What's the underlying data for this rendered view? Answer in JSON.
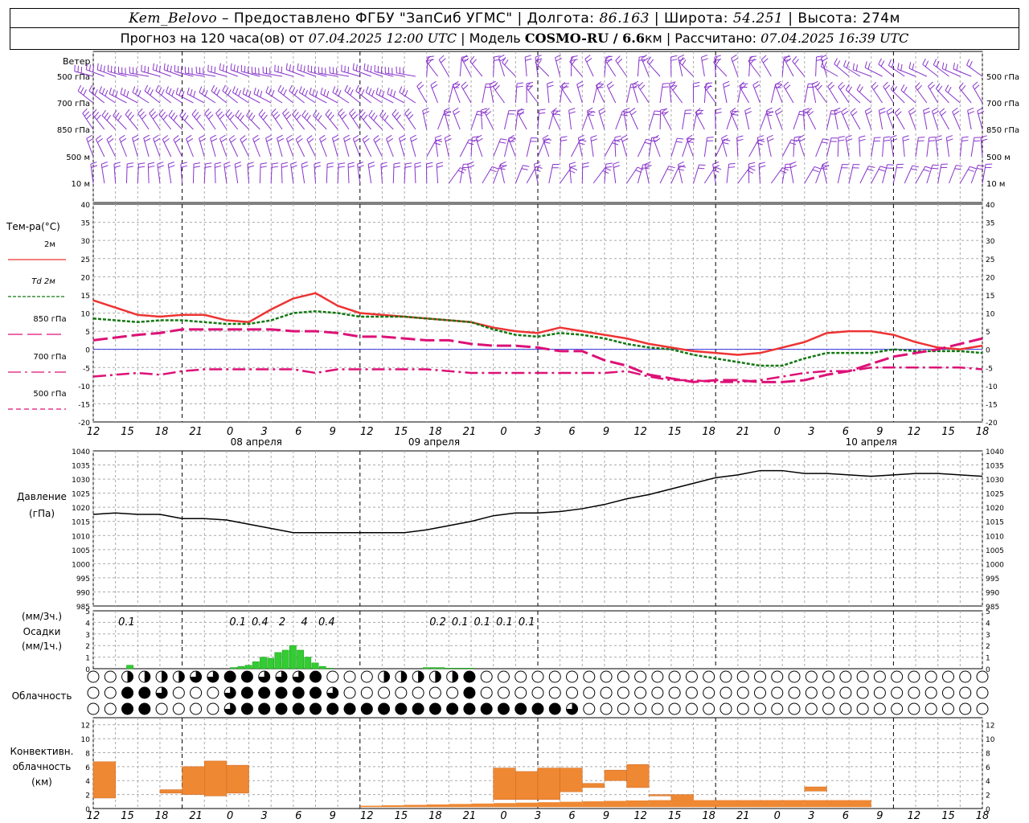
{
  "header": {
    "station": "Kem_Belovo",
    "provided_label": "– Предоставлено ФГБУ \"ЗапСиб УГМС\" | Долгота:",
    "lon": "86.163",
    "lat_label": "| Широта:",
    "lat": "54.251",
    "alt_label": "| Высота:",
    "alt": "274м",
    "forecast_label": "Прогноз на 120 часа(ов) от",
    "init_time": "07.04.2025 12:00 UTC",
    "model_label": "| Модель",
    "model": "COSMO-RU / 6.6",
    "model_unit": "км",
    "calc_label": "| Рассчитано:",
    "calc_time": "07.04.2025 16:39 UTC"
  },
  "wind_panel": {
    "title": "Ветер",
    "levels": [
      "500 гПа",
      "700 гПа",
      "850 гПа",
      "500 м",
      "10 м"
    ],
    "right_levels": [
      "500 гПа",
      "700 гПа",
      "850 гПа",
      "500 м",
      "10 м"
    ]
  },
  "temp_panel": {
    "title": "Тем-ра(°С)",
    "legend": [
      {
        "label": "2м",
        "color": "#ee3333"
      },
      {
        "label": "Td 2м",
        "color": "#117711"
      },
      {
        "label": "850 гПа",
        "color": "#dd1177"
      },
      {
        "label": "700 гПа",
        "color": "#dd1177"
      },
      {
        "label": "500 гПа",
        "color": "#dd1177"
      }
    ]
  },
  "pressure_panel": {
    "title": "Давление",
    "unit": "(гПа)"
  },
  "precip_panel": {
    "unit3": "(мм/3ч.)",
    "title": "Осадки",
    "unit1": "(мм/1ч.)"
  },
  "cloud_panel": {
    "title": "Облачность"
  },
  "conv_panel": {
    "title1": "Конвективн.",
    "title2": "облачность",
    "unit": "(км)"
  },
  "time_axis": {
    "labels": [
      "12",
      "15",
      "18",
      "21",
      "0",
      "3",
      "6",
      "9",
      "12",
      "15",
      "18",
      "21",
      "0",
      "3",
      "6",
      "9",
      "12",
      "15",
      "18",
      "21",
      "0",
      "3",
      "6",
      "9",
      "12",
      "15",
      "18"
    ],
    "dates": [
      "08 апреля",
      "09 апреля",
      "10 апреля"
    ]
  },
  "colors": {
    "wind": "#8833cc",
    "precip": "#33cc33",
    "conv": "#ee8833",
    "grid": "#aaaaaa",
    "zero": "#3333dd"
  },
  "chart_data": [
    {
      "type": "line",
      "title": "Тем-ра(°С)",
      "x_hours_from_init": [
        0,
        6,
        9,
        12,
        15,
        18,
        21,
        24,
        27,
        30,
        33,
        36,
        39,
        42,
        45,
        48,
        51,
        54,
        57,
        60,
        63,
        66,
        69,
        72,
        75,
        78,
        81,
        84,
        87,
        90,
        93,
        96,
        99,
        102,
        105,
        108,
        111,
        114,
        117,
        120
      ],
      "ylim": [
        -20,
        40
      ],
      "ticks": [
        40,
        35,
        30,
        25,
        20,
        15,
        10,
        5,
        0,
        -5,
        -10,
        -15,
        -20
      ],
      "series": [
        {
          "name": "2м",
          "values": [
            13.5,
            9.5,
            9,
            9.5,
            9.5,
            8,
            7.5,
            11,
            14,
            15.5,
            12,
            10,
            9.5,
            9,
            8.5,
            8,
            7.5,
            6,
            5,
            4.5,
            6,
            5,
            4,
            3,
            1.5,
            0.5,
            -0.5,
            -1,
            -1.5,
            -1,
            0.5,
            2,
            4.5,
            5,
            5,
            4,
            2,
            0.5,
            0,
            1
          ]
        },
        {
          "name": "Td 2м",
          "values": [
            8.5,
            7.5,
            8,
            8,
            7.5,
            7,
            7,
            8,
            10,
            10.5,
            10,
            9,
            9,
            9,
            8.5,
            8,
            7.5,
            5.5,
            4,
            3.5,
            4.5,
            4,
            3,
            1.5,
            0.5,
            0,
            -1.5,
            -2.5,
            -3.5,
            -4.5,
            -4.5,
            -2.5,
            -1,
            -1,
            -1,
            0,
            -0.5,
            -0.5,
            -0.5,
            -1
          ]
        },
        {
          "name": "850 гПа",
          "values": [
            2.5,
            4,
            4.5,
            5.5,
            5.5,
            5.5,
            5.5,
            5.5,
            5,
            5,
            4.5,
            3.5,
            3.5,
            3,
            2.5,
            2.5,
            1.5,
            1,
            1,
            0.5,
            -0.5,
            -0.5,
            -3,
            -4.5,
            -7,
            -8,
            -9,
            -8.5,
            -8.5,
            -9,
            -9,
            -8.5,
            -7,
            -6,
            -4,
            -2,
            -1,
            0,
            1.5,
            3
          ]
        },
        {
          "name": "700 гПа",
          "values": [
            -7.5,
            -6.5,
            -7,
            -6,
            -5.5,
            -5.5,
            -5.5,
            -5.5,
            -5.5,
            -6.5,
            -5.5,
            -5.5,
            -5.5,
            -5.5,
            -5.5,
            -6,
            -6.5,
            -6.5,
            -6.5,
            -6.5,
            -6.5,
            -6.5,
            -6.5,
            -6,
            -7.5,
            -8.5,
            -8.5,
            -9,
            -9,
            -8.5,
            -7.5,
            -6.5,
            -6,
            -6,
            -5,
            -5,
            -5,
            -5,
            -5,
            -5.5
          ]
        }
      ]
    },
    {
      "type": "line",
      "title": "Давление",
      "ylabel": "(гПа)",
      "ylim": [
        985,
        1040
      ],
      "ticks": [
        1040,
        1035,
        1030,
        1025,
        1020,
        1015,
        1010,
        1005,
        1000,
        995,
        990,
        985
      ],
      "x_hours_from_init": [
        0,
        3,
        6,
        9,
        12,
        15,
        18,
        21,
        24,
        27,
        30,
        33,
        36,
        39,
        42,
        45,
        48,
        51,
        54,
        57,
        60,
        63,
        66,
        69,
        72,
        75,
        78,
        81,
        84,
        87,
        90,
        93,
        96,
        99,
        102,
        105,
        108,
        111,
        114,
        117,
        120
      ],
      "values": [
        1017.5,
        1018,
        1017.5,
        1017.5,
        1016,
        1016,
        1015.5,
        1014,
        1012.5,
        1011,
        1011,
        1011,
        1011,
        1011,
        1011,
        1012,
        1013.5,
        1015,
        1017,
        1018,
        1018,
        1018.5,
        1019.5,
        1021,
        1023,
        1024.5,
        1026.5,
        1028.5,
        1030.5,
        1031.5,
        1033,
        1033,
        1032,
        1032,
        1031.5,
        1031,
        1031.5,
        1032,
        1032,
        1031.5,
        1031
      ]
    },
    {
      "type": "bar",
      "title": "Осадки",
      "ylabel": "(мм/1ч.)",
      "ylim": [
        0,
        5
      ],
      "ticks": [
        5,
        4,
        3,
        2,
        1,
        0
      ],
      "x_hours_from_init": [
        5,
        19,
        20,
        21,
        22,
        23,
        24,
        25,
        26,
        27,
        28,
        29,
        30,
        31,
        32,
        45,
        46,
        47,
        48,
        49,
        50,
        51
      ],
      "values_hourly": [
        0.3,
        0.1,
        0.2,
        0.3,
        0.6,
        1,
        0.9,
        1.4,
        1.6,
        2,
        1.6,
        1,
        0.5,
        0.2,
        0.05,
        0.1,
        0.1,
        0.1,
        0.05,
        0.05,
        0.05,
        0.05
      ],
      "labels_3h": [
        {
          "x_hours_from_init": 4.5,
          "text": "0.1"
        },
        {
          "x_hours_from_init": 19.5,
          "text": "0.1"
        },
        {
          "x_hours_from_init": 22.5,
          "text": "0.4"
        },
        {
          "x_hours_from_init": 25.5,
          "text": "2"
        },
        {
          "x_hours_from_init": 28.5,
          "text": "4"
        },
        {
          "x_hours_from_init": 31.5,
          "text": "0.4"
        },
        {
          "x_hours_from_init": 46.5,
          "text": "0.2"
        },
        {
          "x_hours_from_init": 49.5,
          "text": "0.1"
        },
        {
          "x_hours_from_init": 52.5,
          "text": "0.1"
        },
        {
          "x_hours_from_init": 55.5,
          "text": "0.1"
        },
        {
          "x_hours_from_init": 58.5,
          "text": "0.1"
        }
      ]
    },
    {
      "type": "bar",
      "title": "Конвективн. облачность",
      "ylabel": "(км)",
      "ylim": [
        0,
        13
      ],
      "ticks": [
        12,
        10,
        8,
        6,
        4,
        2,
        0
      ],
      "ranges_km": [
        {
          "h": 0.5,
          "bottom": 1.5,
          "top": 6.7
        },
        {
          "h": 3.5,
          "bottom": 2.2,
          "top": 2.7
        },
        {
          "h": 4.5,
          "bottom": 2,
          "top": 6
        },
        {
          "h": 5.5,
          "bottom": 1.8,
          "top": 6.8
        },
        {
          "h": 6.5,
          "bottom": 2.2,
          "top": 6.2
        },
        {
          "h": 18.5,
          "bottom": 1.3,
          "top": 5.8
        },
        {
          "h": 19.5,
          "bottom": 1.3,
          "top": 5.3
        },
        {
          "h": 20.5,
          "bottom": 1.3,
          "top": 5.8
        },
        {
          "h": 21.5,
          "bottom": 2.4,
          "top": 5.8
        },
        {
          "h": 22.5,
          "bottom": 3,
          "top": 3.6
        },
        {
          "h": 23.5,
          "bottom": 4,
          "top": 5.5
        },
        {
          "h": 24.5,
          "bottom": 3,
          "top": 6.3
        },
        {
          "h": 25.5,
          "bottom": 1.8,
          "top": 2
        },
        {
          "h": 26.5,
          "bottom": 1,
          "top": 2
        },
        {
          "h": 29.5,
          "bottom": 0.5,
          "top": 1
        },
        {
          "h": 32.5,
          "bottom": 2.5,
          "top": 3.1
        },
        {
          "h": 33.5,
          "bottom": 0.5,
          "top": 0.8
        }
      ],
      "flat_layer_hours": [
        36,
        120
      ],
      "flat_layer_km": [
        0.4,
        1.2
      ]
    }
  ]
}
